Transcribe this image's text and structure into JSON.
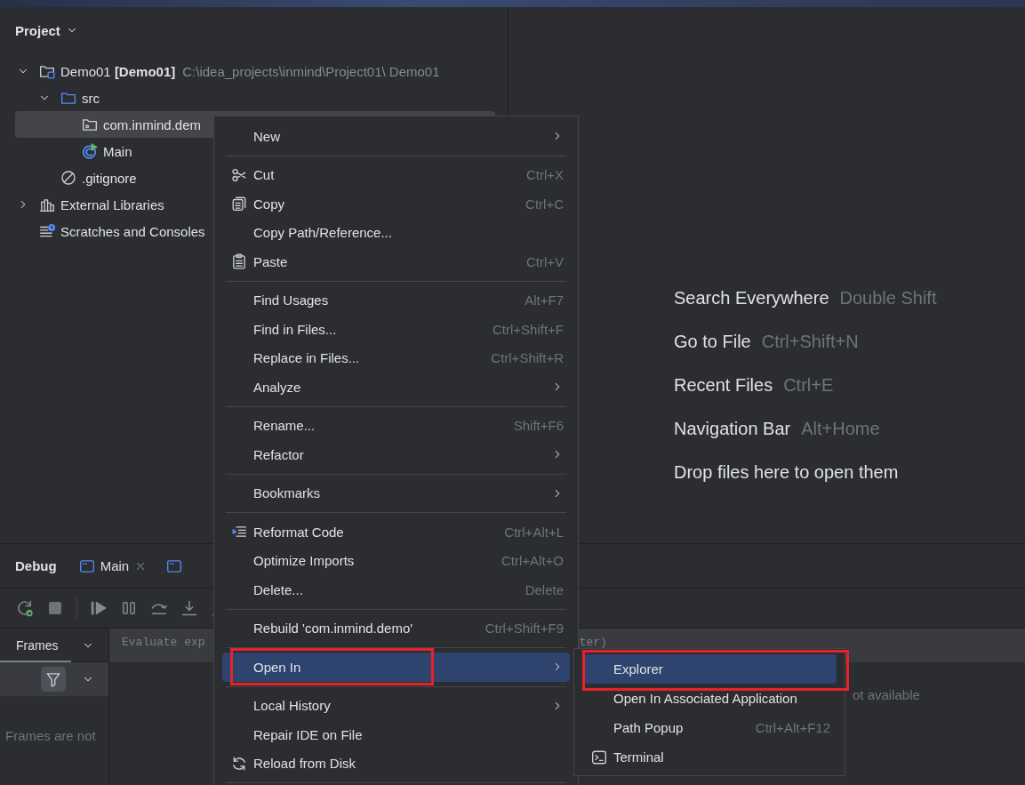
{
  "project_panel": {
    "title": "Project",
    "tree": [
      {
        "kind": "module",
        "label": "Demo01 **[Demo01]**",
        "path": "C:\\idea_projects\\inmind\\Project01\\ Demo01",
        "expanded": true,
        "selected": false,
        "children": [
          {
            "kind": "folder",
            "label": "src",
            "expanded": true,
            "selected": false,
            "children": [
              {
                "kind": "package",
                "label": "com.inmind.dem",
                "selected": true
              },
              {
                "kind": "class",
                "label": "Main",
                "selected": false
              }
            ]
          },
          {
            "kind": "ignore-file",
            "label": ".gitignore",
            "selected": false
          }
        ]
      },
      {
        "kind": "library",
        "label": "External Libraries",
        "expanded": false,
        "selected": false
      },
      {
        "kind": "scratches",
        "label": "Scratches and Consoles",
        "selected": false
      }
    ]
  },
  "editor_hints": [
    {
      "label": "Search Everywhere",
      "shortcut": "Double Shift"
    },
    {
      "label": "Go to File",
      "shortcut": "Ctrl+Shift+N"
    },
    {
      "label": "Recent Files",
      "shortcut": "Ctrl+E"
    },
    {
      "label": "Navigation Bar",
      "shortcut": "Alt+Home"
    },
    {
      "label": "Drop files here to open them"
    }
  ],
  "debug_panel": {
    "title": "Debug",
    "tabs": [
      {
        "label": "Main"
      }
    ],
    "frames": {
      "title": "Frames",
      "message": "Frames are not"
    },
    "evaluate": {
      "placeholder": "Evaluate exp",
      "trailing_text": "ter)"
    },
    "variables_message": "ot available"
  },
  "context_menu": {
    "items": [
      {
        "kind": "item",
        "label": "New",
        "submenu": true,
        "selected": false
      },
      {
        "kind": "separator"
      },
      {
        "kind": "item",
        "label": "Cut",
        "shortcut": "Ctrl+X",
        "submenu": false,
        "selected": false
      },
      {
        "kind": "item",
        "label": "Copy",
        "shortcut": "Ctrl+C",
        "submenu": false,
        "selected": false
      },
      {
        "kind": "item",
        "label": "Copy Path/Reference...",
        "submenu": false,
        "selected": false
      },
      {
        "kind": "item",
        "label": "Paste",
        "shortcut": "Ctrl+V",
        "submenu": false,
        "selected": false
      },
      {
        "kind": "separator"
      },
      {
        "kind": "item",
        "label": "Find Usages",
        "shortcut": "Alt+F7",
        "submenu": false,
        "selected": false
      },
      {
        "kind": "item",
        "label": "Find in Files...",
        "shortcut": "Ctrl+Shift+F",
        "submenu": false,
        "selected": false
      },
      {
        "kind": "item",
        "label": "Replace in Files...",
        "shortcut": "Ctrl+Shift+R",
        "submenu": false,
        "selected": false
      },
      {
        "kind": "item",
        "label": "Analyze",
        "submenu": true,
        "selected": false
      },
      {
        "kind": "separator"
      },
      {
        "kind": "item",
        "label": "Rename...",
        "shortcut": "Shift+F6",
        "submenu": false,
        "selected": false
      },
      {
        "kind": "item",
        "label": "Refactor",
        "submenu": true,
        "selected": false
      },
      {
        "kind": "separator"
      },
      {
        "kind": "item",
        "label": "Bookmarks",
        "submenu": true,
        "selected": false
      },
      {
        "kind": "separator"
      },
      {
        "kind": "item",
        "label": "Reformat Code",
        "shortcut": "Ctrl+Alt+L",
        "submenu": false,
        "selected": false
      },
      {
        "kind": "item",
        "label": "Optimize Imports",
        "shortcut": "Ctrl+Alt+O",
        "submenu": false,
        "selected": false
      },
      {
        "kind": "item",
        "label": "Delete...",
        "shortcut": "Delete",
        "submenu": false,
        "selected": false
      },
      {
        "kind": "separator"
      },
      {
        "kind": "item",
        "label": "Rebuild 'com.inmind.demo'",
        "shortcut": "Ctrl+Shift+F9",
        "submenu": false,
        "selected": false
      },
      {
        "kind": "separator"
      },
      {
        "kind": "item",
        "label": "Open In",
        "submenu": true,
        "selected": true
      },
      {
        "kind": "separator"
      },
      {
        "kind": "item",
        "label": "Local History",
        "submenu": true,
        "selected": false
      },
      {
        "kind": "item",
        "label": "Repair IDE on File",
        "submenu": false,
        "selected": false
      },
      {
        "kind": "item",
        "label": "Reload from Disk",
        "submenu": false,
        "selected": false
      },
      {
        "kind": "separator"
      }
    ]
  },
  "submenu": {
    "items": [
      {
        "kind": "item",
        "label": "Explorer",
        "submenu": false,
        "selected": true
      },
      {
        "kind": "item",
        "label": "Open In Associated Application",
        "submenu": false,
        "selected": false
      },
      {
        "kind": "item",
        "label": "Path Popup",
        "shortcut": "Ctrl+Alt+F12",
        "submenu": false,
        "selected": false
      },
      {
        "kind": "item",
        "label": "Terminal",
        "submenu": false,
        "selected": false
      }
    ]
  }
}
